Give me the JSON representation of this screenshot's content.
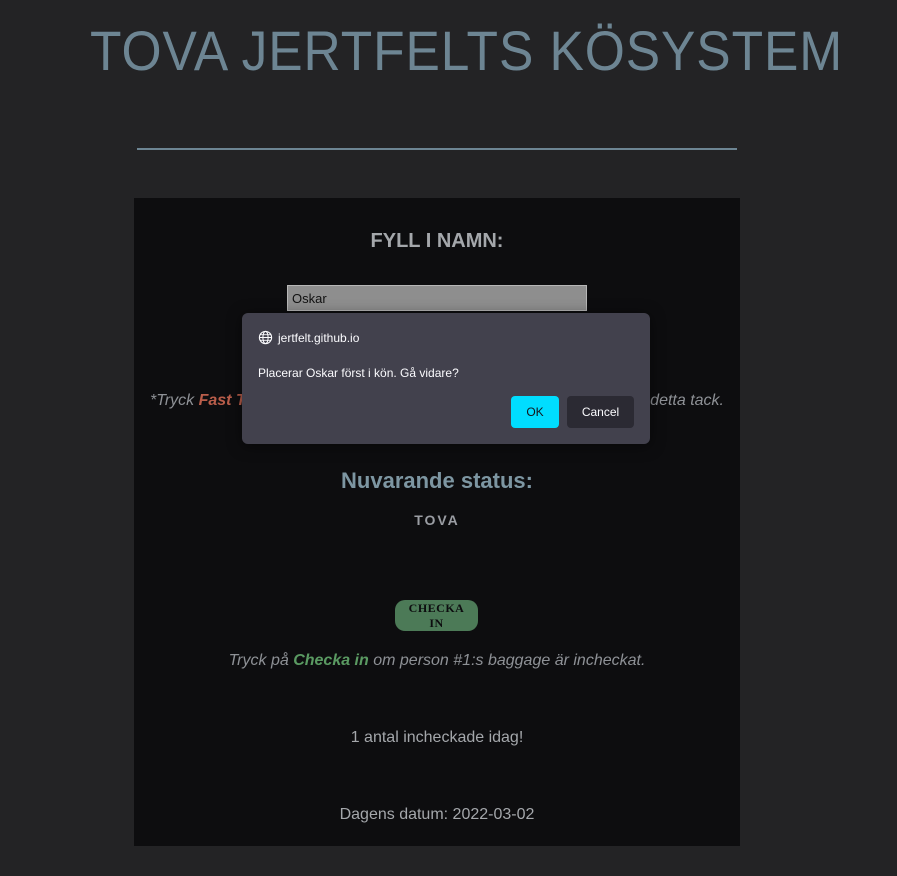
{
  "header": {
    "title": "TOVA JERTFELTS KÖSYSTEM"
  },
  "form": {
    "heading": "FYLL I NAMN:",
    "name_value": "Oskar"
  },
  "hint_fast": {
    "prefix": "*Tryck ",
    "accent": "Fast T",
    "suffix": "detta tack."
  },
  "status": {
    "heading": "Nuvarande status:",
    "value": "TOVA"
  },
  "checkin": {
    "button_label": "CHECKA IN",
    "hint_prefix": "Tryck på ",
    "hint_accent": "Checka in",
    "hint_suffix": " om person #1:s baggage är incheckat."
  },
  "count_text": "1 antal incheckade idag!",
  "date_text": "Dagens datum: 2022-03-02",
  "dialog": {
    "origin": "jertfelt.github.io",
    "message": "Placerar Oskar först i kön. Gå vidare?",
    "ok_label": "OK",
    "cancel_label": "Cancel"
  },
  "colors": {
    "background": "#232325",
    "panel": "#0d0d0f",
    "title": "#6d8593",
    "accent_red": "#b95d4a",
    "accent_green": "#5a9a62",
    "checkin_button": "#4c7a57",
    "dialog_bg": "#42414d",
    "dialog_ok": "#00ddff"
  },
  "icons": {
    "dialog_origin": "globe-icon"
  }
}
